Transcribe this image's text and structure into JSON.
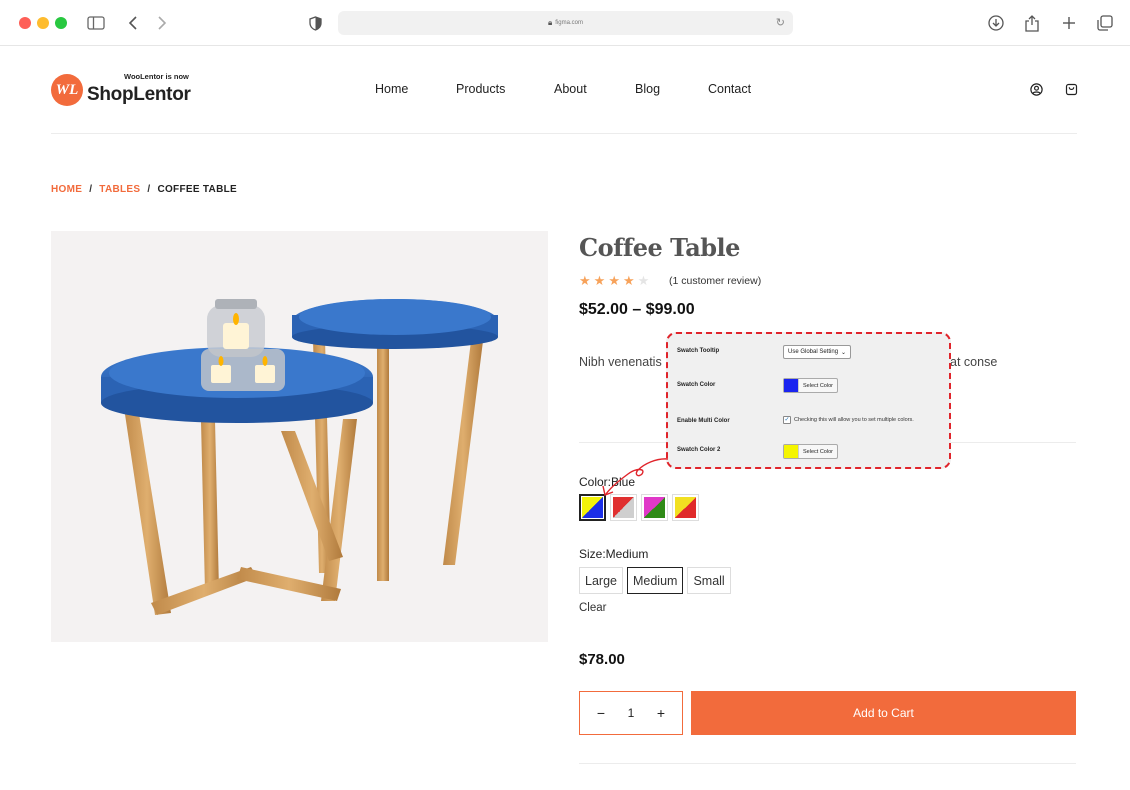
{
  "browser": {
    "url": "figma.com"
  },
  "brand": {
    "mark": "WL",
    "note": "WooLentor is now",
    "name_part1": "Shop",
    "name_part2": "Lentor",
    "color": "#f26b3c"
  },
  "nav": {
    "items": [
      "Home",
      "Products",
      "About",
      "Blog",
      "Contact"
    ]
  },
  "breadcrumb": {
    "items": [
      "HOME",
      "TABLES",
      "COFFEE TABLE"
    ],
    "separator": "/"
  },
  "product": {
    "title": "Coffee Table",
    "rating": 4,
    "rating_max": 5,
    "review_text": "(1 customer review)",
    "price_range": "$52.00 – $99.00",
    "description": "Nibh venenatis                                                    Imperdiet massa tincidunt nunc                                                  urus sit amet volutpat conse",
    "color_label": "Color:Blue",
    "swatches": [
      {
        "name": "blue-yellow",
        "a": "#f2f20a",
        "b": "#1b2ee8",
        "selected": true
      },
      {
        "name": "red-grey",
        "a": "#e03030",
        "b": "#cfcfcf",
        "selected": false
      },
      {
        "name": "pink-green",
        "a": "#e038c8",
        "b": "#2f8a17",
        "selected": false
      },
      {
        "name": "yellow-red",
        "a": "#f2e021",
        "b": "#e02a2a",
        "selected": false
      }
    ],
    "size_label": "Size:Medium",
    "sizes": [
      {
        "label": "Large",
        "selected": false
      },
      {
        "label": "Medium",
        "selected": true
      },
      {
        "label": "Small",
        "selected": false
      }
    ],
    "clear_label": "Clear",
    "variant_price": "$78.00",
    "quantity": "1",
    "qty_minus": "−",
    "qty_plus": "+",
    "add_to_cart": "Add to Cart"
  },
  "settings_panel": {
    "tooltip_label": "Swatch Tooltip",
    "tooltip_value": "Use Global Setting",
    "color_label": "Swatch Color",
    "color_value": "#1a24f0",
    "select_color": "Select Color",
    "multi_label": "Enable Multi Color",
    "multi_checked": true,
    "multi_help": "Checking this will allow you to set multiple colors.",
    "color2_label": "Swatch Color 2",
    "color2_value": "#f5f500"
  },
  "icons": [
    "sidebar-icon",
    "back-icon",
    "forward-icon",
    "shield-icon",
    "lock-icon",
    "reload-icon",
    "download-icon",
    "share-icon",
    "plus-icon",
    "tabs-icon",
    "user-icon",
    "cart-icon"
  ]
}
